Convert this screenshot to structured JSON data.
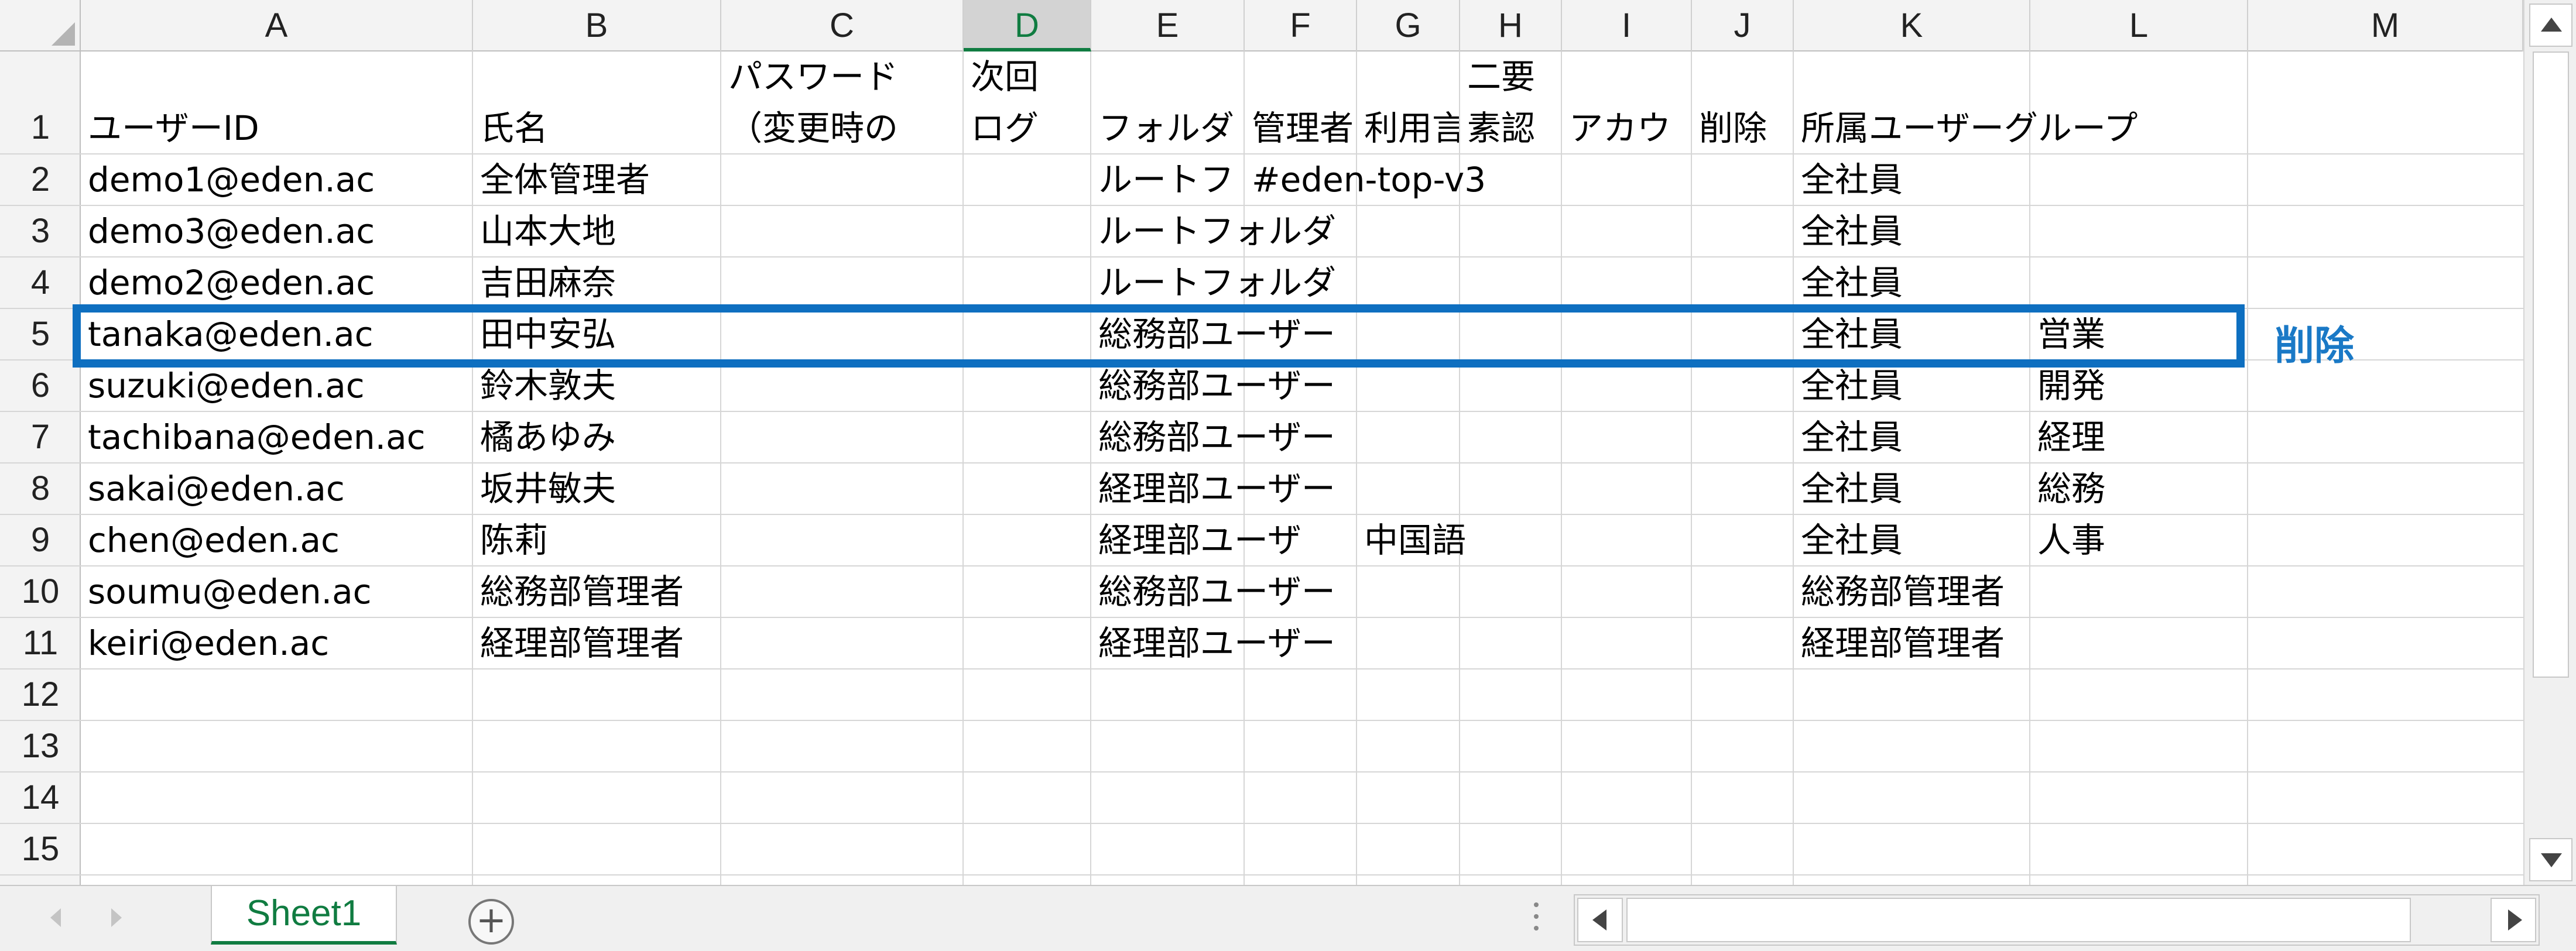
{
  "columns": [
    "A",
    "B",
    "C",
    "D",
    "E",
    "F",
    "G",
    "H",
    "I",
    "J",
    "K",
    "L",
    "M"
  ],
  "selected_column": "D",
  "rows": [
    "1",
    "2",
    "3",
    "4",
    "5",
    "6",
    "7",
    "8",
    "9",
    "10",
    "11",
    "12",
    "13",
    "14",
    "15"
  ],
  "header": {
    "A": "ユーザーID",
    "B": "氏名",
    "C_line1": "パスワード",
    "C_line2": "（変更時の",
    "D_line1": "次回",
    "D_line2": "ログ",
    "E": "フォルダ",
    "F": "管理者",
    "G": "利用言",
    "H_line1": "二要",
    "H_line2": "素認",
    "I": "アカウ",
    "J": "削除",
    "K": "所属ユーザーグループ"
  },
  "data_rows": [
    {
      "A": "demo1@eden.ac",
      "B": "全体管理者",
      "E": "ルートフ",
      "F": "#eden-top-v3",
      "K": "全社員",
      "L": ""
    },
    {
      "A": "demo3@eden.ac",
      "B": "山本大地",
      "E": "ルートフォルダ",
      "F": "",
      "K": "全社員",
      "L": ""
    },
    {
      "A": "demo2@eden.ac",
      "B": "吉田麻奈",
      "E": "ルートフォルダ",
      "F": "",
      "K": "全社員",
      "L": ""
    },
    {
      "A": "tanaka@eden.ac",
      "B": "田中安弘",
      "E": "総務部ユーザー",
      "F": "",
      "K": "全社員",
      "L": "営業"
    },
    {
      "A": "suzuki@eden.ac",
      "B": "鈴木敦夫",
      "E": "総務部ユーザー",
      "F": "",
      "K": "全社員",
      "L": "開発"
    },
    {
      "A": "tachibana@eden.ac",
      "B": "橘あゆみ",
      "E": "総務部ユーザー",
      "F": "",
      "K": "全社員",
      "L": "経理"
    },
    {
      "A": "sakai@eden.ac",
      "B": "坂井敏夫",
      "E": "経理部ユーザー",
      "F": "",
      "K": "全社員",
      "L": "総務"
    },
    {
      "A": "chen@eden.ac",
      "B": "陈莉",
      "E": "経理部ユーザ",
      "G": "中国語",
      "K": "全社員",
      "L": "人事"
    },
    {
      "A": "soumu@eden.ac",
      "B": "総務部管理者",
      "E": "総務部ユーザー",
      "F": "",
      "K": "総務部管理者",
      "L": ""
    },
    {
      "A": "keiri@eden.ac",
      "B": "経理部管理者",
      "E": "経理部ユーザー",
      "F": "",
      "K": "経理部管理者",
      "L": ""
    }
  ],
  "annotation": {
    "label": "削除",
    "color": "#1a79c6",
    "highlight_color": "#0e6fc0"
  },
  "sheet_tab": "Sheet1",
  "add_sheet_symbol": "+",
  "accent_color": "#107c41"
}
